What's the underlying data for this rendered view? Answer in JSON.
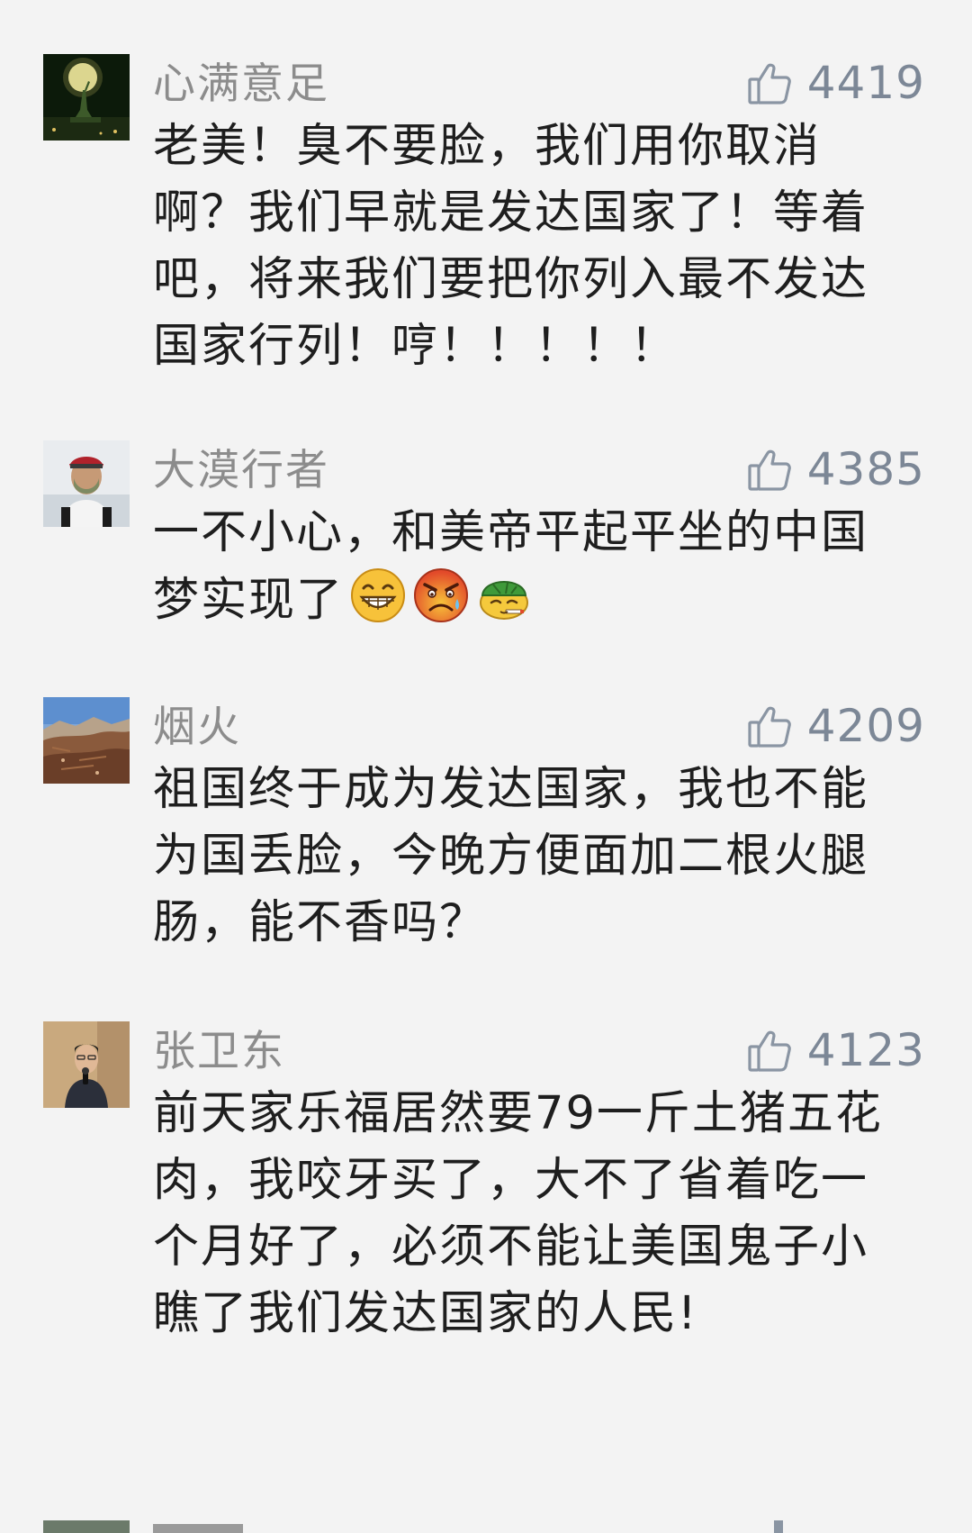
{
  "comments": [
    {
      "username": "心满意足",
      "likes": "4419",
      "text": "老美！臭不要脸，我们用你取消啊？我们早就是发达国家了！等着吧，将来我们要把你列入最不发达国家行列！哼！！！！！",
      "avatar": "statue-of-liberty-night-moon",
      "emojis": []
    },
    {
      "username": "大漠行者",
      "likes": "4385",
      "text": "一不小心，和美帝平起平坐的中国梦实现了",
      "avatar": "cyclist-with-helmet-and-mask",
      "emojis": [
        "grin-emoji",
        "angry-sweat-emoji",
        "turtle-smoking-emoji"
      ]
    },
    {
      "username": "烟火",
      "likes": "4209",
      "text": "祖国终于成为发达国家，我也不能为国丢脸，今晚方便面加二根火腿肠，能不香吗？",
      "avatar": "hillside-landscape",
      "emojis": []
    },
    {
      "username": "张卫东",
      "likes": "4123",
      "text": "前天家乐福居然要79一斤土猪五花肉，我咬牙买了，大不了省着吃一个月好了，必须不能让美国鬼子小瞧了我们发达国家的人民!",
      "avatar": "man-at-microphone",
      "emojis": []
    }
  ],
  "colors": {
    "background": "#f3f3f3",
    "username": "#8c8c8c",
    "like_icon": "#8a95a3",
    "text": "#1e1e1e"
  },
  "icons": {
    "like": "thumbs-up-icon"
  }
}
